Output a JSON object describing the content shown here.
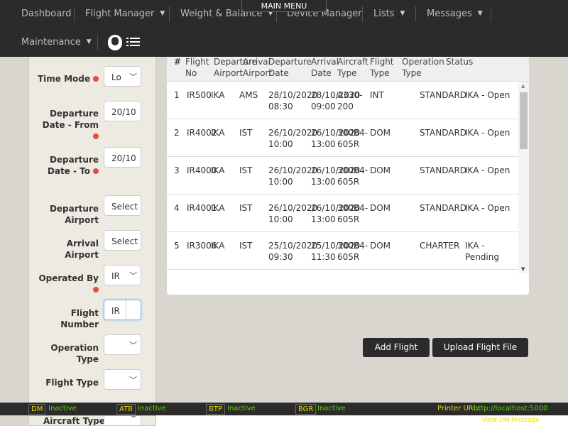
{
  "nav": {
    "main_menu": "MAIN MENU",
    "items": [
      "Dashboard",
      "Flight Manager",
      "Weight & Balance",
      "Device Manager",
      "Lists",
      "Messages",
      "Maintenance"
    ]
  },
  "filters": {
    "time_mode": {
      "label": "Time Mode",
      "value": "Lo"
    },
    "dep_from": {
      "label": "Departure Date - From",
      "value": "20/10"
    },
    "dep_to": {
      "label": "Departure Date - To",
      "value": "20/10"
    },
    "dep_airport": {
      "label": "Departure Airport",
      "value": "Select"
    },
    "arr_airport": {
      "label": "Arrival Airport",
      "value": "Select"
    },
    "operated_by": {
      "label": "Operated By",
      "value": "IR"
    },
    "flight_number": {
      "label": "Flight Number",
      "prefix": "IR",
      "value": ""
    },
    "operation_type": {
      "label": "Operation Type",
      "value": ""
    },
    "flight_type": {
      "label": "Flight Type",
      "value": ""
    },
    "aircraft_type": {
      "label": "Aircraft Type",
      "value": ""
    }
  },
  "table": {
    "headers": [
      "#",
      "Flight\nNo",
      "Departure\nAirport",
      "Arrival\nAirport",
      "Departure\nDate",
      "Arrival\nDate",
      "Aircraft\nType",
      "Flight\nType",
      "Operation\nType",
      "Status"
    ],
    "rows": [
      [
        "1",
        "IR500",
        "IKA",
        "AMS",
        "28/10/2020\n08:30",
        "28/10/2020\n09:00",
        "A330-\n200",
        "INT",
        "STANDARD",
        "IKA - Open"
      ],
      [
        "2",
        "IR4002",
        "IKA",
        "IST",
        "26/10/2020\n10:00",
        "26/10/2020\n13:00",
        "300B4-\n605R",
        "DOM",
        "STANDARD",
        "IKA - Open"
      ],
      [
        "3",
        "IR4000",
        "IKA",
        "IST",
        "26/10/2020\n10:00",
        "26/10/2020\n13:00",
        "300B4-\n605R",
        "DOM",
        "STANDARD",
        "IKA - Open"
      ],
      [
        "4",
        "IR4001",
        "IKA",
        "IST",
        "26/10/2020\n10:00",
        "26/10/2020\n13:00",
        "300B4-\n605R",
        "DOM",
        "STANDARD",
        "IKA - Open"
      ],
      [
        "5",
        "IR3006",
        "IKA",
        "IST",
        "25/10/2020\n09:30",
        "25/10/2020\n11:30",
        "300B4-\n605R",
        "DOM",
        "CHARTER",
        "IKA -\nPending"
      ]
    ]
  },
  "actions": {
    "add": "Add Flight",
    "upload": "Upload Flight File"
  },
  "statusbar": {
    "devices": [
      {
        "tag": "DM",
        "state": "Inactive"
      },
      {
        "tag": "ATB",
        "state": "Inactive"
      },
      {
        "tag": "BTP",
        "state": "Inactive"
      },
      {
        "tag": "BGR",
        "state": "Inactive"
      }
    ],
    "printer_label": "Printer URL:",
    "printer_url": "http://localhost:5000",
    "view_dm": "View DM Message"
  },
  "colors": {
    "topbar": "#2b2b2b",
    "required": "#e84c3d",
    "tag": "#e8d800",
    "active_text": "#5ad400"
  }
}
